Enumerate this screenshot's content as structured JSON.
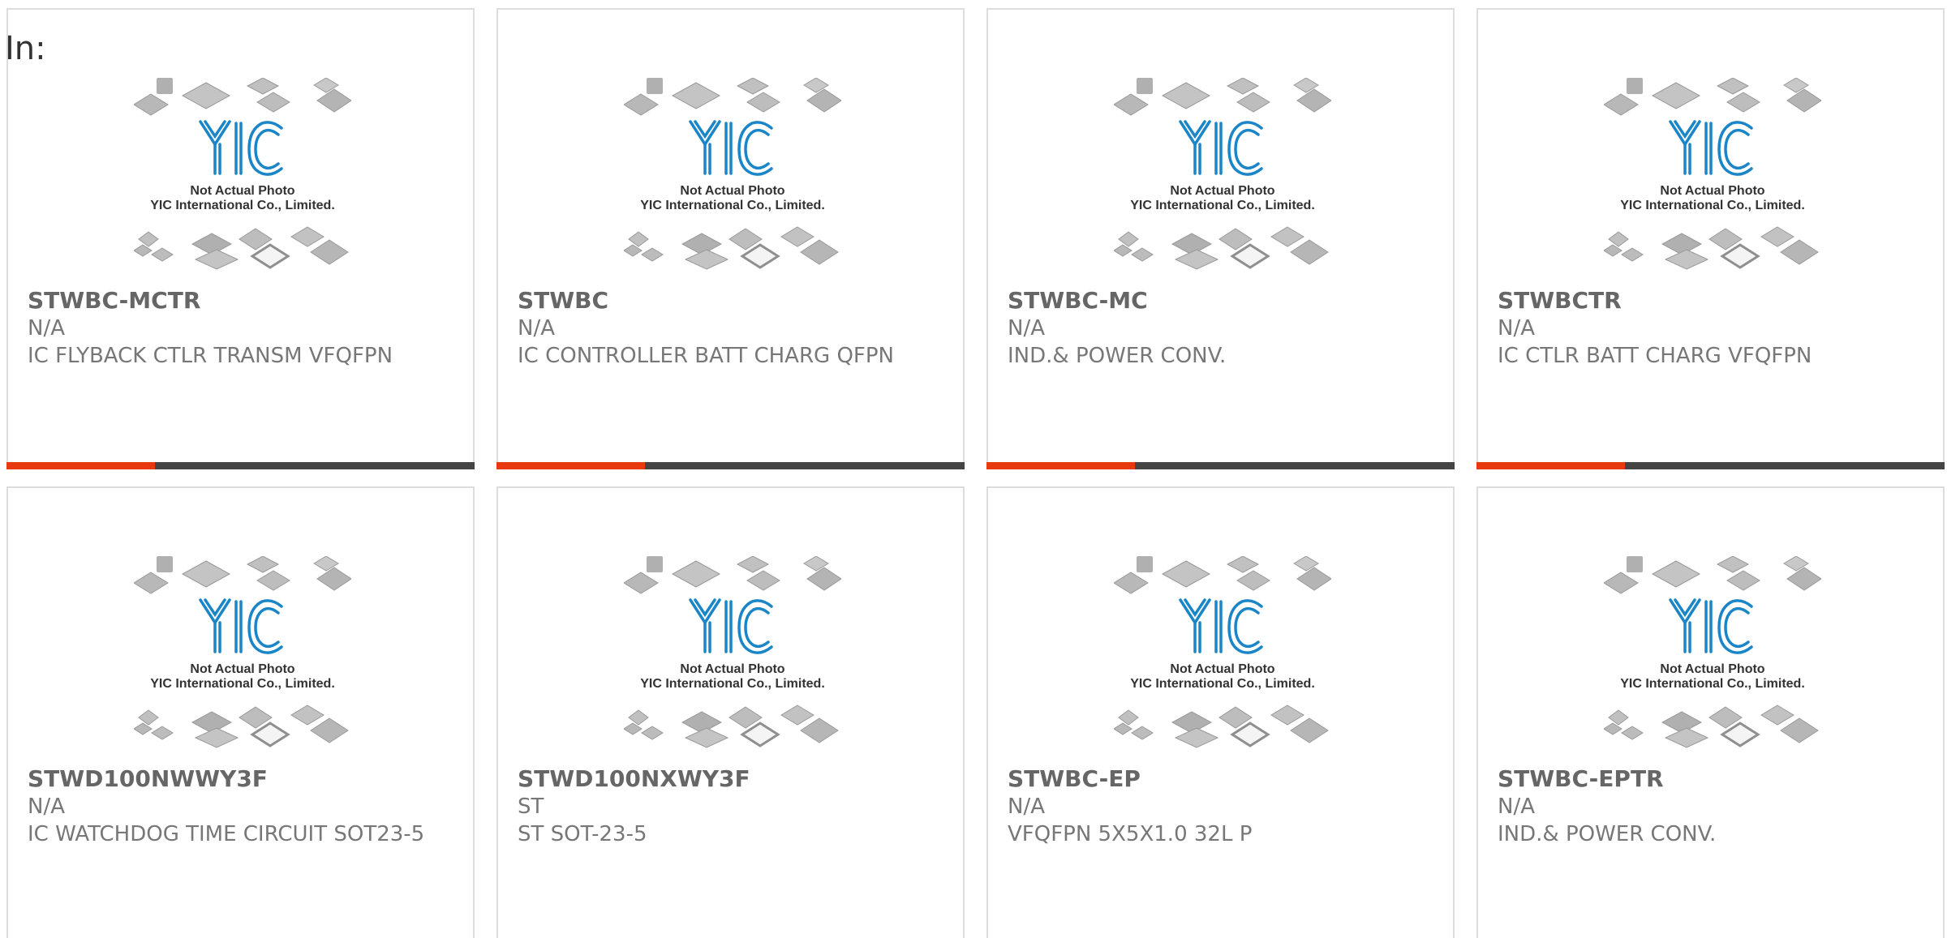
{
  "header": {
    "in_label": "In:"
  },
  "colors": {
    "accent": "#e8380d",
    "bar": "#444444",
    "text": "#777777",
    "border": "#dddddd",
    "logo_blue": "#1a86c7"
  },
  "placeholder": {
    "icon": "yic-placeholder-image",
    "logo_text": "YIC",
    "line1": "Not Actual Photo",
    "line2": "YIC International Co., Limited."
  },
  "products": [
    {
      "part": "STWBC-MCTR",
      "mfr": "N/A",
      "desc": "IC FLYBACK CTLR TRANSM VFQFPN"
    },
    {
      "part": "STWBC",
      "mfr": "N/A",
      "desc": "IC CONTROLLER BATT CHARG QFPN"
    },
    {
      "part": "STWBC-MC",
      "mfr": "N/A",
      "desc": "IND.& POWER CONV."
    },
    {
      "part": "STWBCTR",
      "mfr": "N/A",
      "desc": "IC CTLR BATT CHARG VFQFPN"
    },
    {
      "part": "STWD100NWWY3F",
      "mfr": "N/A",
      "desc": "IC WATCHDOG TIME CIRCUIT SOT23-5"
    },
    {
      "part": "STWD100NXWY3F",
      "mfr": "ST",
      "desc": "ST SOT-23-5"
    },
    {
      "part": "STWBC-EP",
      "mfr": "N/A",
      "desc": "VFQFPN 5X5X1.0 32L P"
    },
    {
      "part": "STWBC-EPTR",
      "mfr": "N/A",
      "desc": "IND.& POWER CONV."
    }
  ]
}
